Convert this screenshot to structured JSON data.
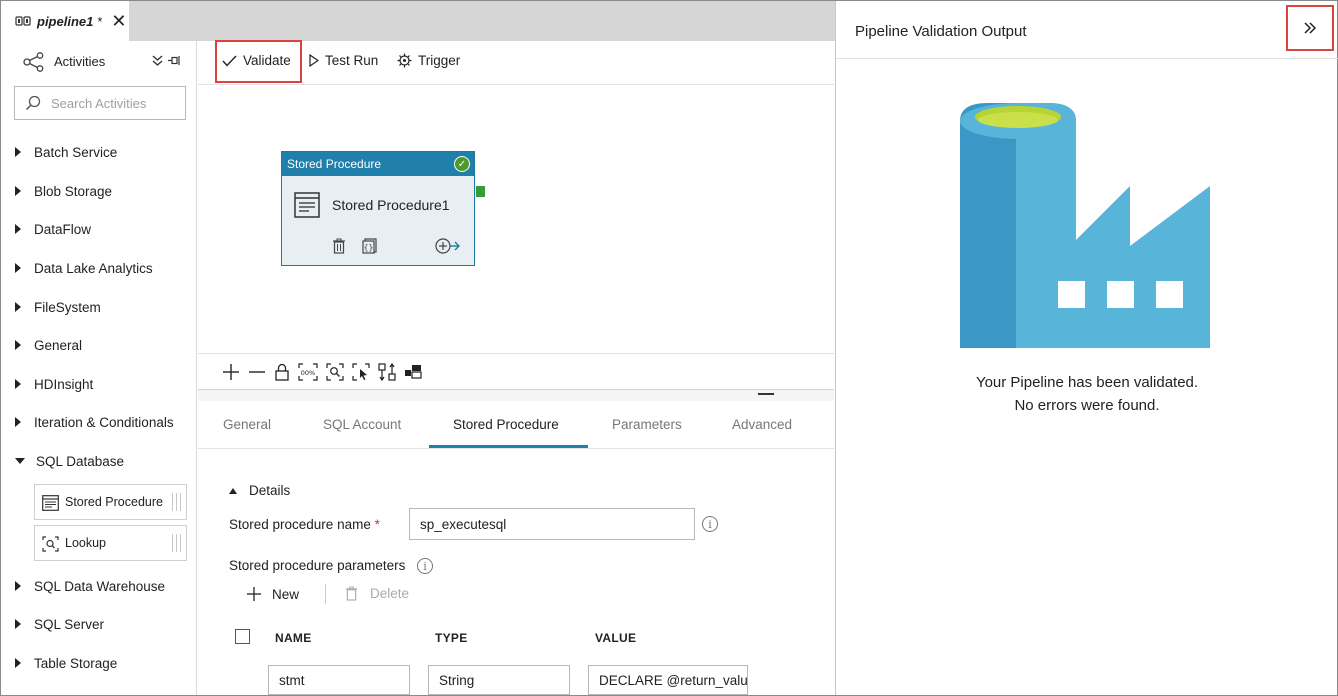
{
  "tab": {
    "name": "pipeline1",
    "dirty_marker": "*",
    "icon": "pipeline-icon",
    "close_icon": "close-icon"
  },
  "activities_panel": {
    "title": "Activities",
    "collapse_icon": "double-chevron-down-icon",
    "pin_icon": "pin-icon",
    "search_placeholder": "Search Activities",
    "categories": [
      {
        "label": "Batch Service",
        "expanded": false
      },
      {
        "label": "Blob Storage",
        "expanded": false
      },
      {
        "label": "DataFlow",
        "expanded": false
      },
      {
        "label": "Data Lake Analytics",
        "expanded": false
      },
      {
        "label": "FileSystem",
        "expanded": false
      },
      {
        "label": "General",
        "expanded": false
      },
      {
        "label": "HDInsight",
        "expanded": false
      },
      {
        "label": "Iteration & Conditionals",
        "expanded": false
      },
      {
        "label": "SQL Database",
        "expanded": true
      },
      {
        "label": "SQL Data Warehouse",
        "expanded": false
      },
      {
        "label": "SQL Server",
        "expanded": false
      },
      {
        "label": "Table Storage",
        "expanded": false
      }
    ],
    "sql_database_items": [
      {
        "label": "Stored Procedure",
        "icon": "stored-procedure-icon"
      },
      {
        "label": "Lookup",
        "icon": "lookup-icon"
      }
    ]
  },
  "toolbar": {
    "validate_label": "Validate",
    "test_run_label": "Test Run",
    "trigger_label": "Trigger"
  },
  "node": {
    "type_label": "Stored Procedure",
    "name": "Stored Procedure1",
    "status": "validated"
  },
  "canvas_tools": [
    "zoom-in-icon",
    "zoom-out-icon",
    "lock-icon",
    "zoom-100-icon",
    "fit-to-screen-icon",
    "select-icon",
    "auto-align-icon",
    "minimap-icon"
  ],
  "properties": {
    "tabs": [
      "General",
      "SQL Account",
      "Stored Procedure",
      "Parameters",
      "Advanced"
    ],
    "active_tab": "Stored Procedure",
    "details_label": "Details",
    "sp_name_label": "Stored procedure name",
    "sp_name_required": "*",
    "sp_name_value": "sp_executesql",
    "sp_params_label": "Stored procedure parameters",
    "new_label": "New",
    "delete_label": "Delete",
    "columns": [
      "NAME",
      "TYPE",
      "VALUE"
    ],
    "rows": [
      {
        "name": "stmt",
        "type": "String",
        "value": "DECLARE @return_value"
      }
    ]
  },
  "validation_panel": {
    "title": "Pipeline Validation Output",
    "collapse_icon": "double-chevron-right-icon",
    "message_line1": "Your Pipeline has been validated.",
    "message_line2": "No errors were found.",
    "illustration": "data-factory-icon",
    "colors": {
      "dark_blue": "#3a97c6",
      "light_blue": "#59b4d9",
      "lime": "#b8d432"
    }
  },
  "colors": {
    "accent": "#217fab",
    "highlight": "#d9453e",
    "success": "#4d9b2b"
  }
}
